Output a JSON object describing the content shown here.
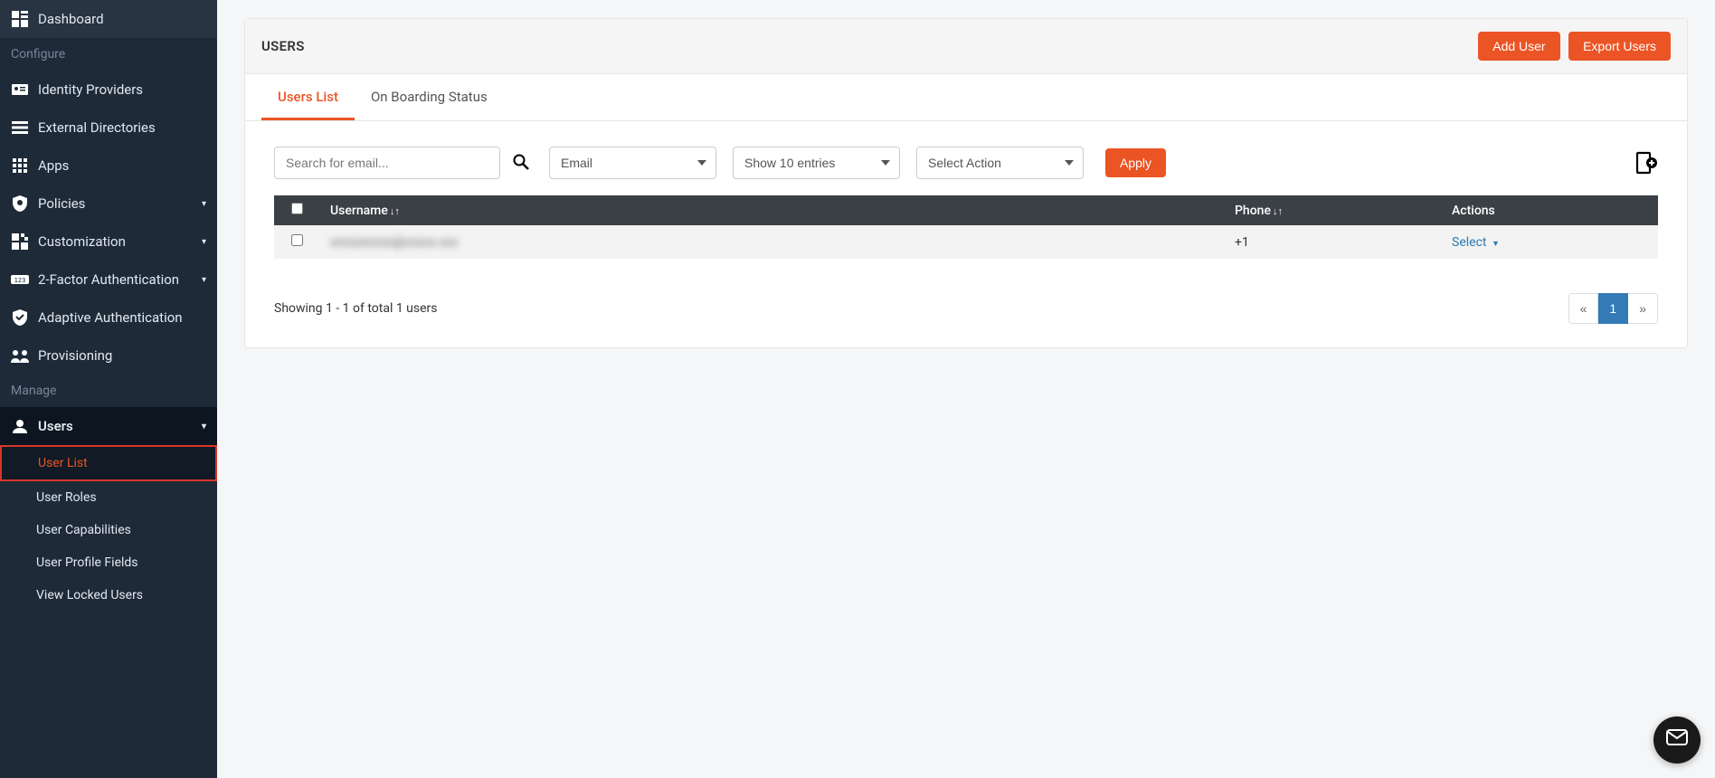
{
  "sidebar": {
    "configure_label": "Configure",
    "manage_label": "Manage",
    "items": {
      "dashboard": "Dashboard",
      "identity_providers": "Identity Providers",
      "external_directories": "External Directories",
      "apps": "Apps",
      "policies": "Policies",
      "customization": "Customization",
      "two_factor": "2-Factor Authentication",
      "adaptive_auth": "Adaptive Authentication",
      "provisioning": "Provisioning",
      "users": "Users"
    },
    "users_sub": {
      "user_list": "User List",
      "user_roles": "User Roles",
      "user_capabilities": "User Capabilities",
      "user_profile_fields": "User Profile Fields",
      "view_locked_users": "View Locked Users"
    }
  },
  "header": {
    "title": "USERS",
    "add_user": "Add User",
    "export_users": "Export Users"
  },
  "tabs": {
    "users_list": "Users List",
    "onboarding": "On Boarding Status"
  },
  "filters": {
    "search_placeholder": "Search for email...",
    "email_opt": "Email",
    "show_entries_opt": "Show 10 entries",
    "select_action_opt": "Select Action",
    "apply": "Apply"
  },
  "table": {
    "headers": {
      "username": "Username",
      "phone": "Phone",
      "actions": "Actions"
    },
    "rows": [
      {
        "username": "xxxxxxxxxx@xxxxx.xxx",
        "phone": "+1",
        "action": "Select"
      }
    ]
  },
  "footer": {
    "showing": "Showing 1 - 1 of total 1 users",
    "prev": "«",
    "page": "1",
    "next": "»"
  }
}
